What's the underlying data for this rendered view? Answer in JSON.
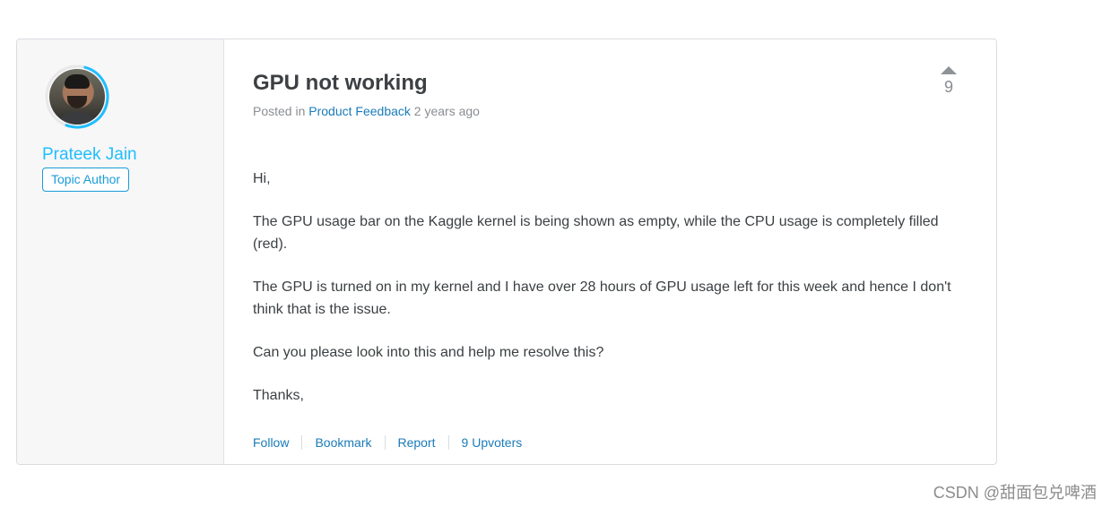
{
  "post": {
    "title": "GPU not working",
    "meta": {
      "posted_in_label": "Posted in",
      "category": "Product Feedback",
      "time_ago": "2 years ago"
    },
    "votes": {
      "count": "9",
      "up_icon": "triangle-up-icon"
    },
    "body": [
      "Hi,",
      "The GPU usage bar on the Kaggle kernel is being shown as empty, while the CPU usage is completely filled (red).",
      "The GPU is turned on in my kernel and I have over 28 hours of GPU usage left for this week and hence I don't think that is the issue.",
      "Can you please look into this and help me resolve this?",
      "Thanks,"
    ],
    "actions": [
      "Follow",
      "Bookmark",
      "Report",
      "9 Upvoters"
    ]
  },
  "author": {
    "name": "Prateek Jain",
    "badge": "Topic Author",
    "ring_color": "#20beff"
  },
  "watermark": "CSDN @甜面包兑啤酒",
  "colors": {
    "link": "#1a7bb8",
    "author_name": "#20beff"
  }
}
